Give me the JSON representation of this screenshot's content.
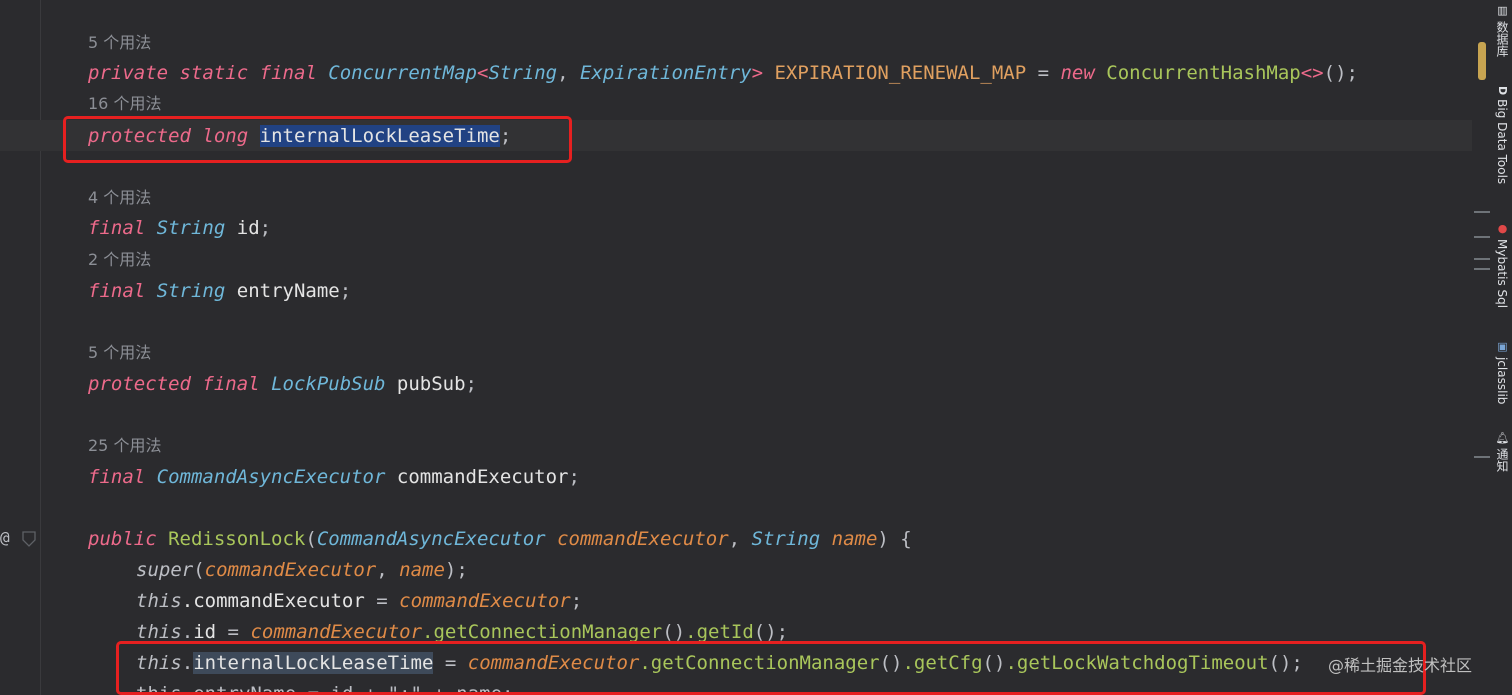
{
  "gutter": {
    "at_symbol": "@"
  },
  "usage_hints": {
    "h1": "5 个用法",
    "h2": "16 个用法",
    "h3": "4 个用法",
    "h4": "2 个用法",
    "h5": "5 个用法",
    "h6": "25 个用法"
  },
  "code": {
    "l1": {
      "mod1": "private",
      "mod2": "static",
      "mod3": "final",
      "type": "ConcurrentMap",
      "lt": "<",
      "t1": "String",
      "comma": ", ",
      "t2": "ExpirationEntry",
      "gt": ">",
      "name": "EXPIRATION_RENEWAL_MAP",
      "eq": " = ",
      "new": "new",
      "cls": "ConcurrentHashMap",
      "diamond": "<>",
      "tail": "();"
    },
    "l2": {
      "mod1": "protected",
      "mod2": "long",
      "field": "internalLockLeaseTime",
      "semi": ";"
    },
    "l3": {
      "mod": "final",
      "type": "String",
      "field": "id",
      "semi": ";"
    },
    "l4": {
      "mod": "final",
      "type": "String",
      "field": "entryName",
      "semi": ";"
    },
    "l5": {
      "mod1": "protected",
      "mod2": "final",
      "type": "LockPubSub",
      "field": "pubSub",
      "semi": ";"
    },
    "l6": {
      "mod": "final",
      "type": "CommandAsyncExecutor",
      "field": "commandExecutor",
      "semi": ";"
    },
    "l7": {
      "mod": "public",
      "name": "RedissonLock",
      "lp": "(",
      "t1": "CommandAsyncExecutor",
      "p1": "commandExecutor",
      "comma": ", ",
      "t2": "String",
      "p2": "name",
      "tail": ") {"
    },
    "l8": {
      "kw": "super",
      "lp": "(",
      "p1": "commandExecutor",
      "comma": ", ",
      "p2": "name",
      "tail": ");"
    },
    "l9": {
      "kw": "this",
      "field": ".commandExecutor",
      "eq": " = ",
      "p": "commandExecutor",
      "semi": ";"
    },
    "l10": {
      "kw": "this",
      "dot": ".",
      "field": "id",
      "eq": " = ",
      "p": "commandExecutor",
      "m1": ".getConnectionManager",
      "c1": "()",
      "m2": ".getId",
      "tail": "();"
    },
    "l11": {
      "kw": "this",
      "dot": ".",
      "field": "internalLockLeaseTime",
      "eq": " = ",
      "p": "commandExecutor",
      "m1": ".getConnectionManager",
      "c1": "()",
      "m2": ".getCfg",
      "c2": "()",
      "m3": ".getLockWatchdogTimeout",
      "tail": "();"
    },
    "l12": {
      "text": "this.entryName = id + \":\" + name;"
    }
  },
  "right_toolbar": {
    "database": "数据库",
    "big_data_tools": "Big Data Tools",
    "mybatis_sql": "Mybatis Sql",
    "jclasslib": "jclasslib",
    "notifications": "通知"
  },
  "watermark": "@稀土掘金技术社区",
  "colors": {
    "background": "#2b2b2e",
    "highlight_box": "#e62020",
    "scroll_thumb": "#c7a451"
  }
}
